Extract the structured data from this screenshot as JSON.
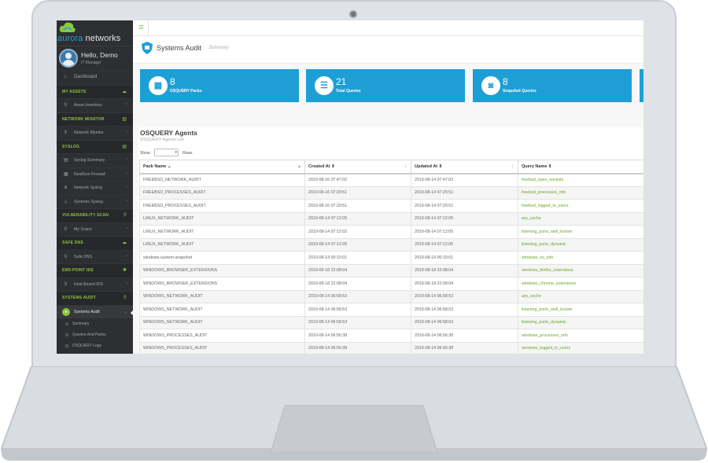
{
  "brand": {
    "logo_a": "aurora",
    "logo_b": " networks"
  },
  "profile": {
    "greeting": "Hello, Demo",
    "role": "IT Manager"
  },
  "nav": {
    "dashboard": "Dashboard",
    "sections": [
      {
        "title": "MY ASSETS",
        "items": [
          "Asset Inventory"
        ]
      },
      {
        "title": "NETWORK MONITOR",
        "items": [
          "Network Monitor"
        ]
      },
      {
        "title": "SYSLOG",
        "items": [
          "Syslog Summary",
          "NextGen Firewall",
          "Network Syslog",
          "Systems Syslog"
        ]
      },
      {
        "title": "VULNERABILITY SCAN",
        "items": [
          "My Scans"
        ]
      },
      {
        "title": "SAFE DNS",
        "items": [
          "Safe DNS"
        ]
      },
      {
        "title": "END-POINT IDS",
        "items": [
          "Host Based IDS"
        ]
      },
      {
        "title": "SYSTEMS AUDIT",
        "items": [
          "Systems Audit"
        ]
      }
    ],
    "audit_sub": [
      "Summary",
      "Queries And Packs",
      "OSQUERY Logs"
    ]
  },
  "page": {
    "title": "Systems Audit",
    "subtitle": "Summary"
  },
  "cards": [
    {
      "value": "8",
      "label": "OSQUERY Packs",
      "icon": "grid-icon"
    },
    {
      "value": "21",
      "label": "Total Queries",
      "icon": "list-icon"
    },
    {
      "value": "8",
      "label": "Snapshot Queries",
      "icon": "camera-icon"
    }
  ],
  "agents": {
    "title": "OSQUERY Agents",
    "subtitle": "OSQUERY Agents List",
    "show_label": "Show",
    "rows_label": "Rows",
    "columns": [
      "Pack Name",
      "Created At",
      "Updated At",
      "Query Name"
    ],
    "rows": [
      [
        "FREEBSD_NETWORK_AUDIT",
        "2019-08-16 07:47:02",
        "2019-08-14 07:47:02",
        "freebsd_open_sockets"
      ],
      [
        "FREEBSD_PROCESSES_AUDIT",
        "2019-08-16 07:20:51",
        "2019-08-14 07:20:51",
        "freebsd_processes_info"
      ],
      [
        "FREEBSD_PROCESSES_AUDIT",
        "2019-08-16 07:20:51",
        "2019-08-14 07:20:51",
        "freebsd_logged_in_users"
      ],
      [
        "LINUX_NETWORK_AUDIT",
        "2019-08-14 07:12:05",
        "2019-08-14 07:12:05",
        "arp_cache"
      ],
      [
        "LINUX_NETWORK_AUDIT",
        "2019-08-14 07:12:02",
        "2019-08-14 07:12:05",
        "listening_ports_well_known"
      ],
      [
        "LINUX_NETWORK_AUDIT",
        "2019-08-14 07:12:05",
        "2019-08-14 07:12:05",
        "listening_ports_dynamic"
      ],
      [
        "windows-system-snapshot",
        "2019-08-14 00:10:01",
        "2019-08-14 00:10:01",
        "windows_os_info"
      ],
      [
        "WINDOWS_BROWSER_EXTENSIONS",
        "2019-08-18 22:08:04",
        "2019-08-18 22:08:04",
        "windows_firefox_extensions"
      ],
      [
        "WINDOWS_BROWSER_EXTENSIONS",
        "2019-08-18 22:08:04",
        "2019-08-18 22:08:04",
        "windows_chrome_extensions"
      ],
      [
        "WINDOWS_NETWORK_AUDIT",
        "2019-08-14 06:58:53",
        "2019-08-14 06:58:53",
        "arp_cache"
      ],
      [
        "WINDOWS_NETWORK_AUDIT",
        "2019-08-14 06:58:53",
        "2019-08-14 06:58:53",
        "listening_ports_well_known"
      ],
      [
        "WINDOWS_NETWORK_AUDIT",
        "2019-08-14 06:58:53",
        "2019-08-14 06:58:53",
        "listening_ports_dynamic"
      ],
      [
        "WINDOWS_PROCESSES_AUDIT",
        "2019-08-14 06:56:38",
        "2019-08-14 06:56:38",
        "windows_processes_info"
      ],
      [
        "WINDOWS_PROCESSES_AUDIT",
        "2019-08-14 06:56:38",
        "2019-08-14 06:56:38",
        "windows_logged_in_users"
      ]
    ]
  },
  "colors": {
    "accent": "#8cc63f",
    "card": "#1d9fd6",
    "sidebar": "#2d2f32"
  }
}
